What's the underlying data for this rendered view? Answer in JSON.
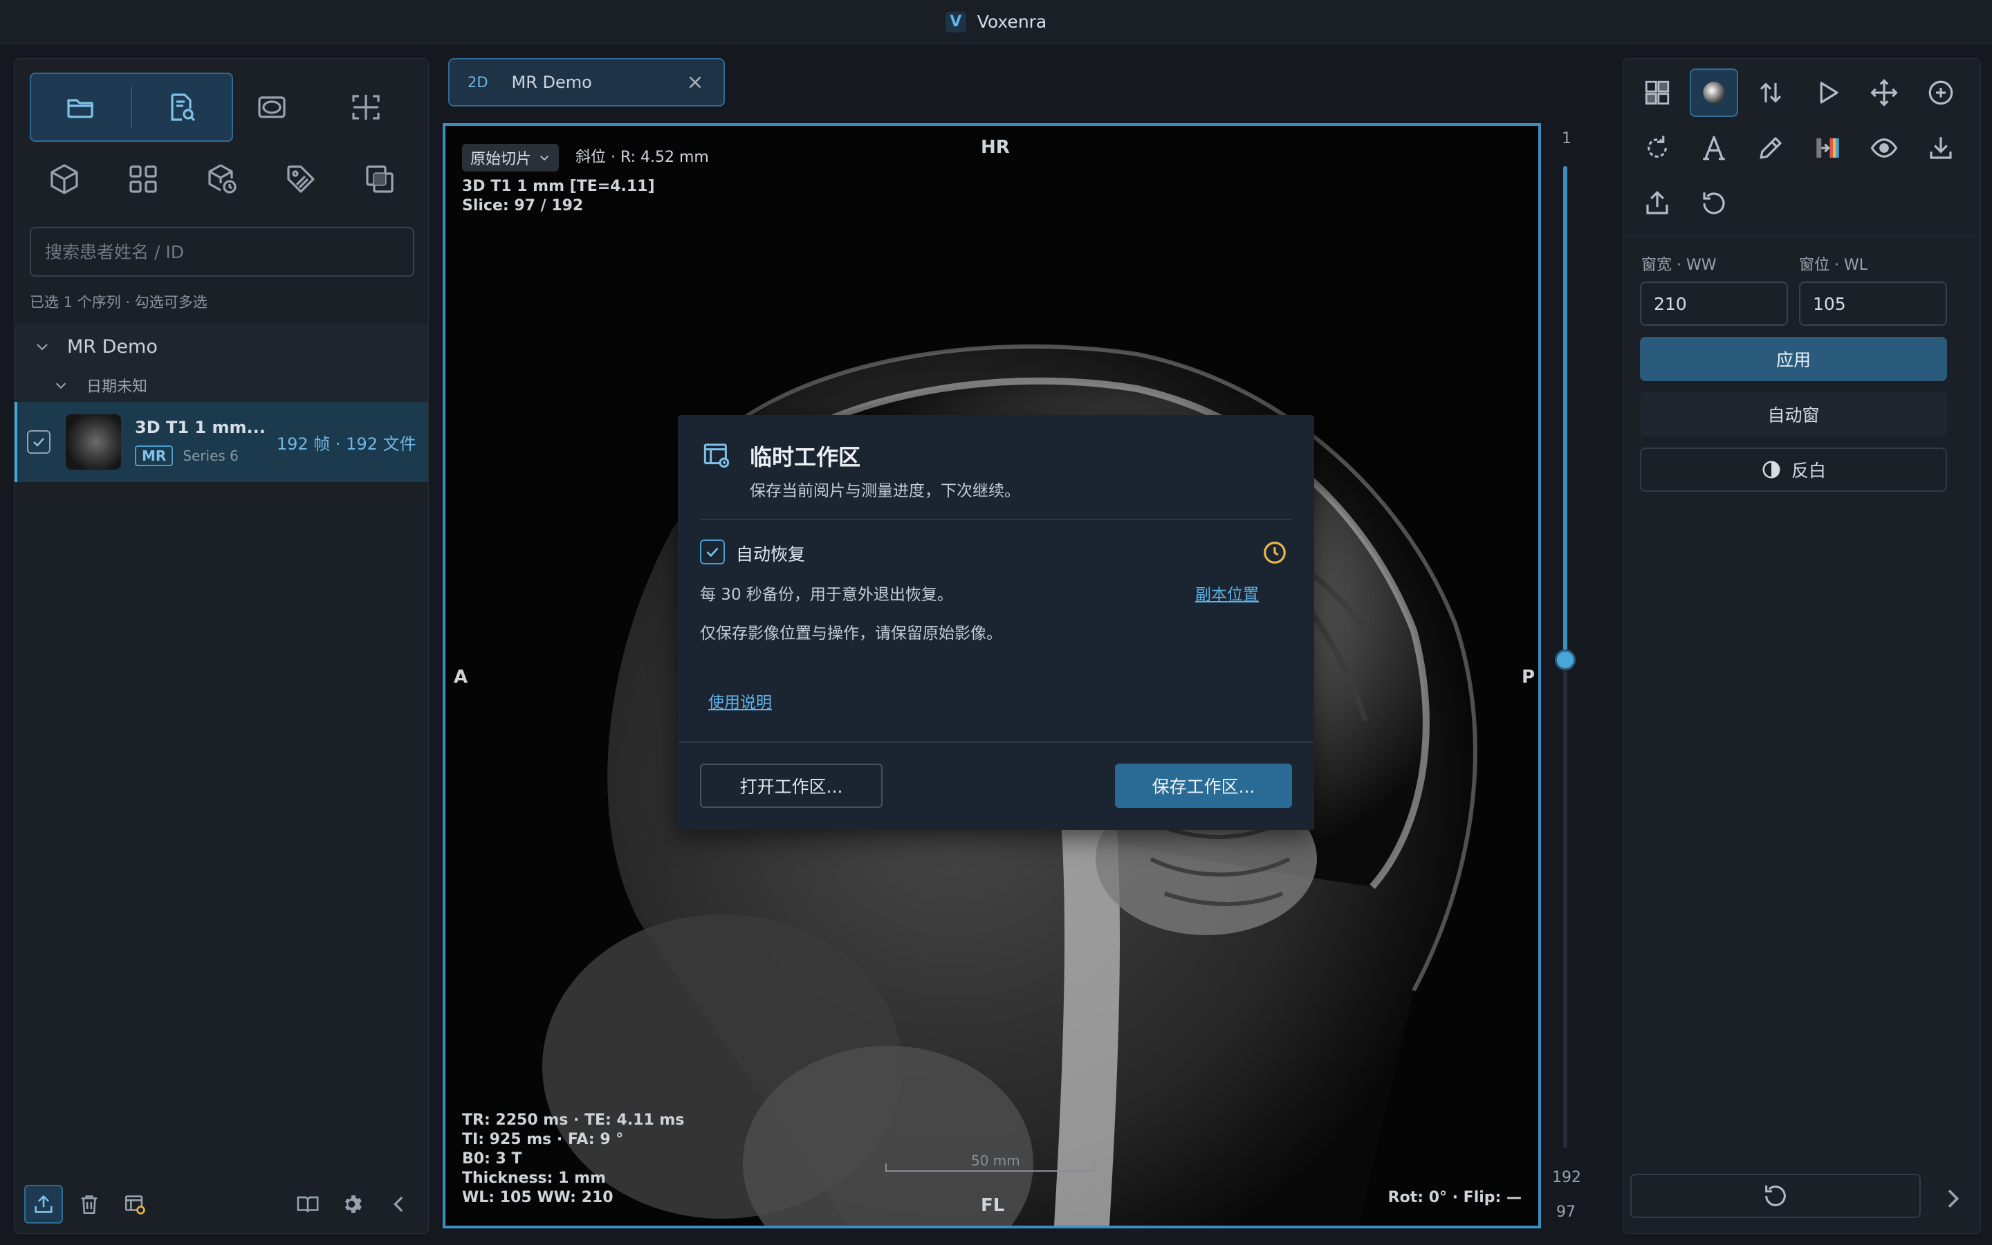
{
  "app": {
    "title": "Voxenra",
    "logo": "V"
  },
  "left_panel": {
    "search": {
      "placeholder": "搜索患者姓名 / ID"
    },
    "selection_hint": "已选 1 个序列 · 勾选可多选",
    "patient": {
      "name": "MR Demo"
    },
    "study": {
      "date": "日期未知"
    },
    "series": {
      "name": "3D T1 1 mm...",
      "modality": "MR",
      "number": "Series 6",
      "frames": "192 帧 · 192 文件",
      "checked": true
    },
    "icons": [
      "folder-open-icon",
      "search-document-icon",
      "ellipse-roi-icon",
      "crop-frame-icon",
      "cube-icon",
      "grid-layout-icon",
      "cube-clock-icon",
      "tag-icon",
      "overlay-squares-icon"
    ]
  },
  "viewer": {
    "tab": {
      "mode": "2D",
      "name": "MR Demo"
    },
    "slice_mode": "原始切片",
    "orientation": "斜位 · R: 4.52 mm",
    "series_desc": "3D T1 1 mm [TE=4.11]",
    "slice": "Slice: 97 / 192",
    "labels": {
      "top": "HR",
      "bottom": "FL",
      "left": "A",
      "right": "P"
    },
    "params": [
      "TR: 2250 ms · TE: 4.11 ms",
      "TI: 925 ms · FA: 9 °",
      "B0: 3 T",
      "Thickness: 1 mm",
      "WL: 105   WW: 210"
    ],
    "rotation": "Rot: 0° · Flip: —",
    "scale": "50 mm"
  },
  "slider": {
    "min_label": "1",
    "max_label": "192",
    "current_label": "97",
    "min": 1,
    "max": 192,
    "value": 97
  },
  "right_panel": {
    "ww_label": "窗宽 · WW",
    "wl_label": "窗位 · WL",
    "ww_value": "210",
    "wl_value": "105",
    "apply": "应用",
    "auto_window": "自动窗",
    "invert": "反白"
  },
  "modal": {
    "title": "临时工作区",
    "subtitle": "保存当前阅片与测量进度，下次继续。",
    "auto_restore": "自动恢复",
    "backup_desc": "每 30 秒备份，用于意外退出恢复。",
    "backup_location": "副本位置",
    "note": "仅保存影像位置与操作，请保留原始影像。",
    "help": "使用说明",
    "open_button": "打开工作区...",
    "save_button": "保存工作区..."
  },
  "colors": {
    "accent": "#4aa6d8",
    "warning": "#e8b84a",
    "primary_button": "#2a6b95"
  }
}
